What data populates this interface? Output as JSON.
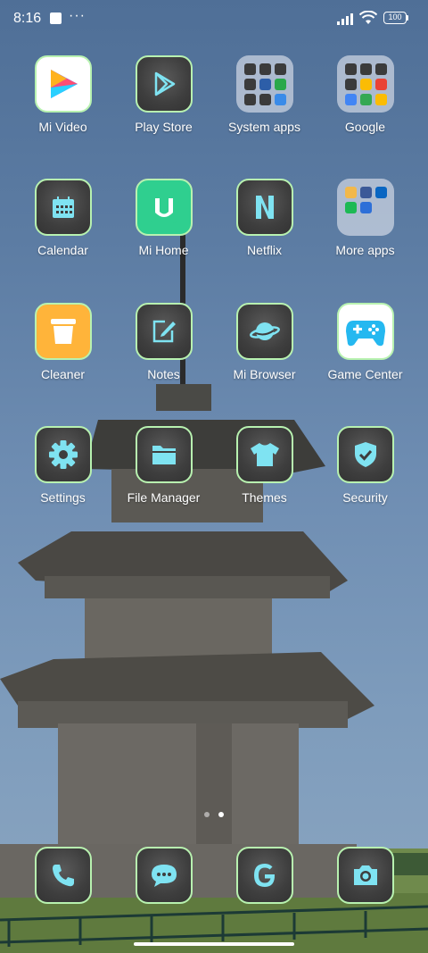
{
  "status_bar": {
    "time": "8:16",
    "battery": "100",
    "notification_icon": "square-notification-icon",
    "more_icon": "ellipsis-icon",
    "signal_icon": "signal-icon",
    "wifi_icon": "wifi-icon"
  },
  "apps": [
    {
      "label": "Mi Video",
      "icon": "mi-video-icon"
    },
    {
      "label": "Play Store",
      "icon": "play-store-icon"
    },
    {
      "label": "System apps",
      "icon": "folder-icon"
    },
    {
      "label": "Google",
      "icon": "folder-icon"
    },
    {
      "label": "Calendar",
      "icon": "calendar-icon"
    },
    {
      "label": "Mi Home",
      "icon": "mi-home-icon"
    },
    {
      "label": "Netflix",
      "icon": "netflix-icon"
    },
    {
      "label": "More apps",
      "icon": "folder-icon"
    },
    {
      "label": "Cleaner",
      "icon": "cleaner-icon"
    },
    {
      "label": "Notes",
      "icon": "notes-icon"
    },
    {
      "label": "Mi Browser",
      "icon": "browser-icon"
    },
    {
      "label": "Game Center",
      "icon": "game-controller-icon"
    },
    {
      "label": "Settings",
      "icon": "gear-icon"
    },
    {
      "label": "File Manager",
      "icon": "folder-file-icon"
    },
    {
      "label": "Themes",
      "icon": "tshirt-icon"
    },
    {
      "label": "Security",
      "icon": "shield-check-icon"
    }
  ],
  "dock": [
    {
      "icon": "phone-icon"
    },
    {
      "icon": "message-icon"
    },
    {
      "icon": "google-g-icon"
    },
    {
      "icon": "camera-icon"
    }
  ],
  "page_indicator": {
    "pages": 2,
    "current": 2
  },
  "colors": {
    "tile_border": "#b8f2b0",
    "glyph": "#7fe3f2",
    "sky": "#5c7ca3"
  }
}
